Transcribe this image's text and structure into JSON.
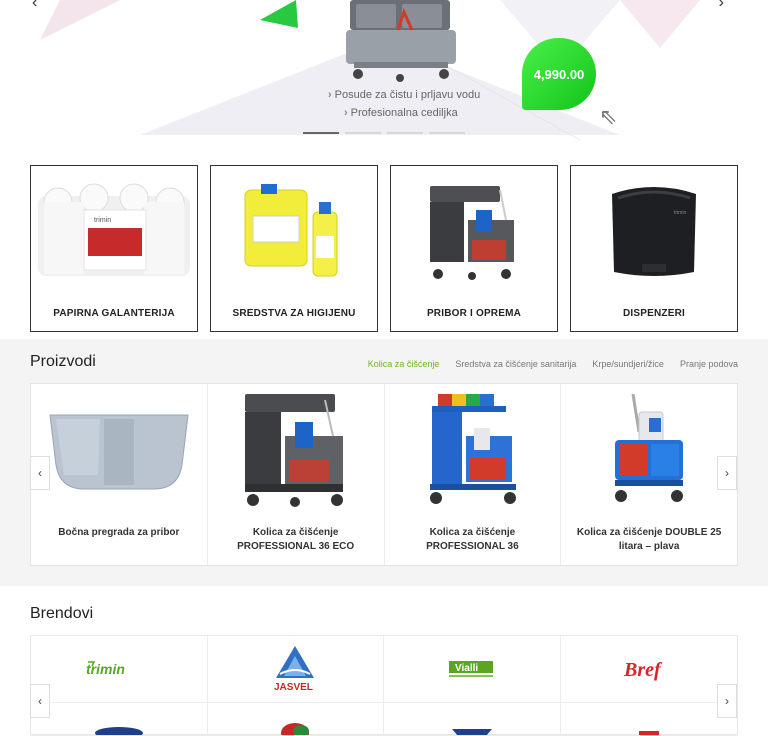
{
  "hero": {
    "slide_lines": [
      "Posude za čistu i prljavu vodu",
      "Profesionalna cediljka"
    ],
    "price": "4,990.00",
    "slide_count": 4,
    "active_slide": 1
  },
  "categories": [
    {
      "label": "PAPIRNA GALANTERIJA",
      "icon": "paper-towel-rolls"
    },
    {
      "label": "SREDSTVA ZA HIGIJENU",
      "icon": "detergent-bottles"
    },
    {
      "label": "PRIBOR I OPREMA",
      "icon": "cleaning-trolley"
    },
    {
      "label": "DISPENZERI",
      "icon": "towel-dispenser"
    }
  ],
  "products": {
    "title": "Proizvodi",
    "filters": [
      "Kolica za čišćenje",
      "Sredstva za čišćenje sanitarija",
      "Krpe/sundjeri/žice",
      "Pranje podova"
    ],
    "active_filter": 0,
    "items": [
      {
        "name": "Bočna pregrada za pribor"
      },
      {
        "name": "Kolica za čišćenje PROFESSIONAL 36 ECO"
      },
      {
        "name": "Kolica za čišćenje PROFESSIONAL 36"
      },
      {
        "name": "Kolica za čišćenje DOUBLE 25 litara – plava"
      }
    ]
  },
  "brands": {
    "title": "Brendovi",
    "logos": [
      "trimin",
      "JASVEL",
      "Vialli",
      "Bref"
    ]
  },
  "colors": {
    "accent_green": "#6ab520",
    "price_green": "#22d428",
    "border_dark": "#333333"
  }
}
